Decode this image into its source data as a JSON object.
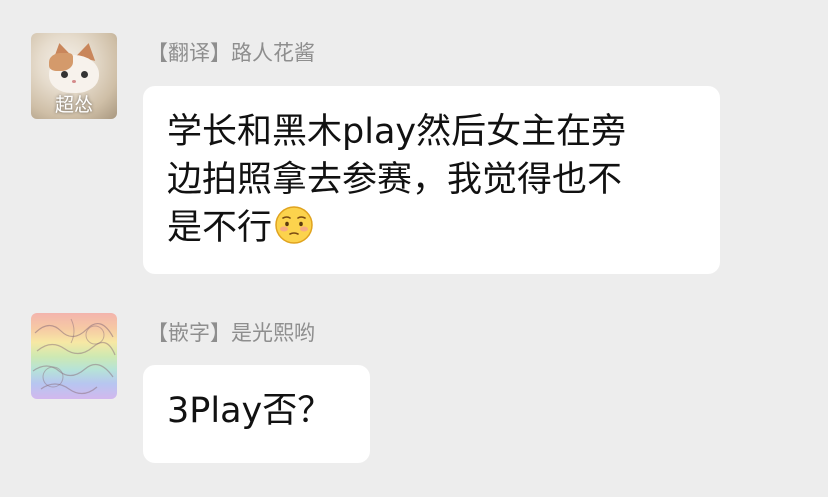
{
  "messages": [
    {
      "sender": "【翻译】路人花酱",
      "avatar": {
        "kind": "cat-photo",
        "caption": "超怂"
      },
      "text_lines": [
        "学长和黑木play然后女主在旁",
        "边拍照拿去参赛，我觉得也不",
        "是不行"
      ],
      "emoji": "worried-blushing-face-icon"
    },
    {
      "sender": "【嵌字】是光熙哟",
      "avatar": {
        "kind": "rainbow-sketch"
      },
      "text_lines": [
        "3Play否？"
      ]
    }
  ],
  "colors": {
    "background": "#ededed",
    "bubble": "#ffffff",
    "sender_text": "#8e8e8e",
    "message_text": "#111111"
  }
}
